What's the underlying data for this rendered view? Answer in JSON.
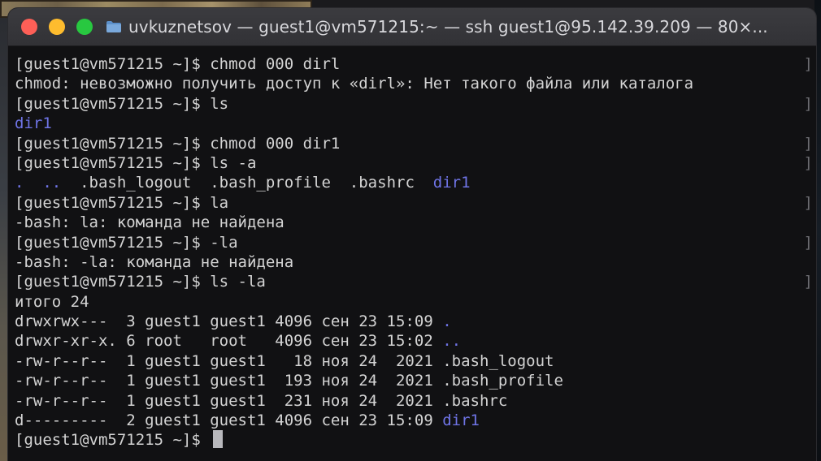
{
  "window": {
    "title": "uvkuznetsov — guest1@vm571215:~ — ssh guest1@95.142.39.209 — 80×..."
  },
  "terminal": {
    "lines": [
      {
        "text": "[guest1@vm571215 ~]$ chmod 000 dirl",
        "bracket": true
      },
      {
        "text": "chmod: невозможно получить доступ к «dirl»: Нет такого файла или каталога",
        "bracket": false
      },
      {
        "text": "[guest1@vm571215 ~]$ ls",
        "bracket": true
      },
      {
        "text": "dir1",
        "bracket": false,
        "color": "blue"
      },
      {
        "text": "[guest1@vm571215 ~]$ chmod 000 dir1",
        "bracket": true
      },
      {
        "text": "[guest1@vm571215 ~]$ ls -a",
        "bracket": true
      },
      {
        "segments": [
          {
            "text": ".  ..  ",
            "color": "blue"
          },
          {
            "text": ".bash_logout  .bash_profile  .bashrc  ",
            "color": "default"
          },
          {
            "text": "dir1",
            "color": "blue"
          }
        ],
        "bracket": false
      },
      {
        "text": "[guest1@vm571215 ~]$ la",
        "bracket": true
      },
      {
        "text": "-bash: la: команда не найдена",
        "bracket": false
      },
      {
        "text": "[guest1@vm571215 ~]$ -la",
        "bracket": true
      },
      {
        "text": "-bash: -la: команда не найдена",
        "bracket": false
      },
      {
        "text": "[guest1@vm571215 ~]$ ls -la",
        "bracket": true
      },
      {
        "text": "итого 24",
        "bracket": false
      },
      {
        "segments": [
          {
            "text": "drwxrwx---  3 guest1 guest1 4096 сен 23 15:09 ",
            "color": "default"
          },
          {
            "text": ".",
            "color": "blue"
          }
        ],
        "bracket": false
      },
      {
        "segments": [
          {
            "text": "drwxr-xr-x. 6 root   root   4096 сен 23 15:02 ",
            "color": "default"
          },
          {
            "text": "..",
            "color": "blue"
          }
        ],
        "bracket": false
      },
      {
        "text": "-rw-r--r--  1 guest1 guest1   18 ноя 24  2021 .bash_logout",
        "bracket": false
      },
      {
        "text": "-rw-r--r--  1 guest1 guest1  193 ноя 24  2021 .bash_profile",
        "bracket": false
      },
      {
        "text": "-rw-r--r--  1 guest1 guest1  231 ноя 24  2021 .bashrc",
        "bracket": false
      },
      {
        "segments": [
          {
            "text": "d---------  2 guest1 guest1 4096 сен 23 15:09 ",
            "color": "default"
          },
          {
            "text": "dir1",
            "color": "blue"
          }
        ],
        "bracket": false
      },
      {
        "text": "[guest1@vm571215 ~]$ ",
        "bracket": false,
        "cursor": true
      }
    ],
    "bracket_char": "]"
  },
  "colors": {
    "text": "#d4d4d4",
    "directory": "#6f74e6",
    "background": "#111113",
    "close": "#fd5f57",
    "minimize": "#febc2e",
    "maximize": "#28c840"
  }
}
